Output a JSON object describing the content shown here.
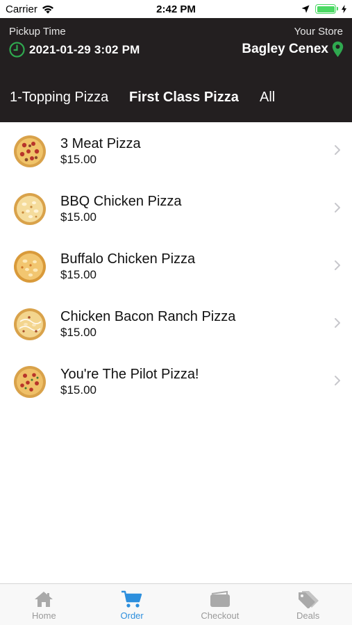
{
  "status_bar": {
    "carrier": "Carrier",
    "time": "2:42 PM"
  },
  "header": {
    "pickup_label": "Pickup Time",
    "pickup_time": "2021-01-29 3:02 PM",
    "store_label": "Your Store",
    "store_name": "Bagley Cenex",
    "accent_green": "#2fa84f",
    "background": "#231f20"
  },
  "tabs": [
    {
      "label": "1-Topping Pizza",
      "active": false
    },
    {
      "label": "First Class Pizza",
      "active": true
    },
    {
      "label": "All",
      "active": false
    }
  ],
  "menu_items": [
    {
      "name": "3 Meat Pizza",
      "price": "$15.00",
      "icon": "pizza-pepperoni-icon"
    },
    {
      "name": "BBQ Chicken Pizza",
      "price": "$15.00",
      "icon": "pizza-chicken-icon"
    },
    {
      "name": "Buffalo Chicken Pizza",
      "price": "$15.00",
      "icon": "pizza-chicken-icon"
    },
    {
      "name": "Chicken Bacon Ranch Pizza",
      "price": "$15.00",
      "icon": "pizza-chicken-icon"
    },
    {
      "name": "You're The Pilot Pizza!",
      "price": "$15.00",
      "icon": "pizza-pepperoni-icon"
    }
  ],
  "tab_bar": {
    "items": [
      {
        "label": "Home",
        "icon": "home-icon",
        "active": false
      },
      {
        "label": "Order",
        "icon": "cart-icon",
        "active": true
      },
      {
        "label": "Checkout",
        "icon": "wallet-icon",
        "active": false
      },
      {
        "label": "Deals",
        "icon": "tags-icon",
        "active": false
      }
    ],
    "active_color": "#2d8fdd",
    "inactive_color": "#9a9a9a"
  }
}
